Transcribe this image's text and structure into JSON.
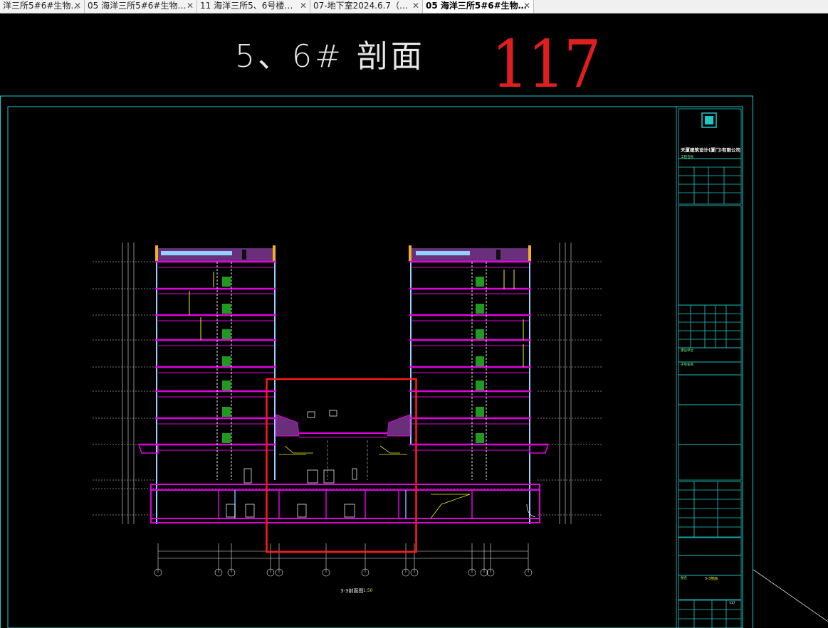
{
  "tabs": [
    {
      "label": "洋三所5#6#生物…",
      "active": false
    },
    {
      "label": "05 海洋三所5#6#生物…",
      "active": false
    },
    {
      "label": "11 海洋三所5、6号楼…",
      "active": false
    },
    {
      "label": "07-地下室2024.6.7（…",
      "active": false
    },
    {
      "label": "05 海洋三所5#6#生物…",
      "active": true
    }
  ],
  "close_glyph": "✕",
  "annotations": {
    "title": "5、6# 剖面",
    "number": "117"
  },
  "drawing": {
    "section_caption": "3-3剖面图",
    "section_scale": "1:50",
    "grid_axes": [
      "5-①",
      "5-③",
      "5-⑤",
      "①-①",
      "①-③",
      "①-⑤",
      "①-⑨",
      "①-①",
      "6-⑨",
      "6-⑦",
      "6-⑤",
      "6-④",
      "6-①"
    ]
  },
  "title_block": {
    "company": "天厦建筑设计(厦门)有限公司",
    "labels": [
      "工程名称",
      "建设单位",
      "子项名称",
      "图名"
    ],
    "drawing_name": "3-3剖面",
    "sheet_no": "117"
  },
  "colors": {
    "frame": "#1fc8c8",
    "floor": "#e000e0",
    "wall": "#9ad0ff",
    "highlight": "#ff1a1a",
    "dimension": "#e6e6e6",
    "accent_yellow": "#f0f020",
    "roof_fill": "#6a2f7a"
  }
}
